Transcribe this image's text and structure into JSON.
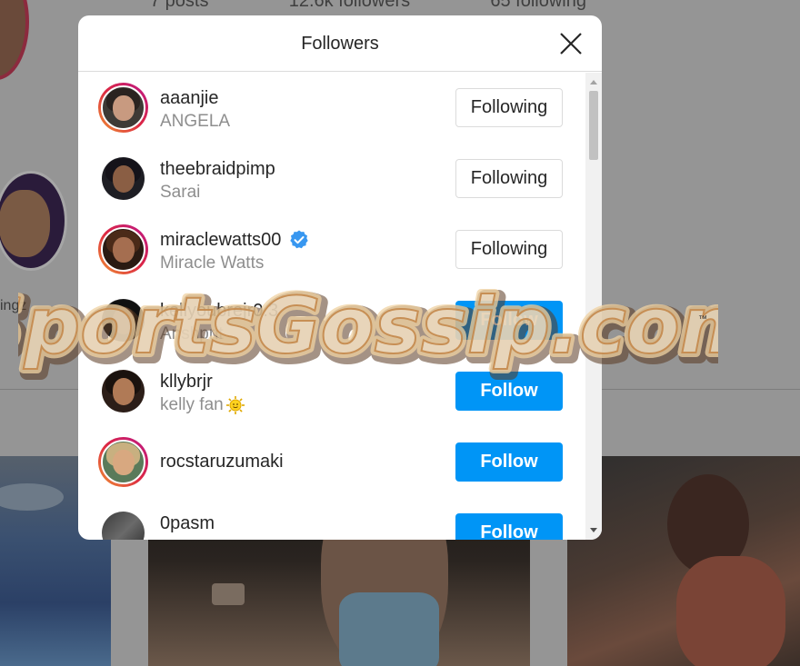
{
  "background": {
    "stats": [
      "7 posts",
      "12.6k followers",
      "65 following"
    ],
    "highlight_label": "ingz"
  },
  "modal": {
    "title": "Followers",
    "close_icon": "close-icon"
  },
  "followers": [
    {
      "username": "aaanjie",
      "full_name": "ANGELA",
      "button": "Following",
      "story_ring": true,
      "verified": false
    },
    {
      "username": "theebraidpimp",
      "full_name": "Sarai",
      "button": "Following",
      "story_ring": false,
      "verified": false
    },
    {
      "username": "miraclewatts00",
      "full_name": "Miracle Watts",
      "button": "Following",
      "story_ring": true,
      "verified": true
    },
    {
      "username": "kellyoubrejr0.3",
      "full_name": "Anshprit",
      "button": "Follow",
      "story_ring": false,
      "verified": false
    },
    {
      "username": "kllybrjr",
      "full_name": "kelly fan",
      "button": "Follow",
      "story_ring": false,
      "verified": false,
      "emoji": "sun-emoji"
    },
    {
      "username": "rocstaruzumaki",
      "full_name": "",
      "button": "Follow",
      "story_ring": true,
      "verified": false
    },
    {
      "username": "0pasm",
      "full_name": "",
      "button": "Follow",
      "story_ring": false,
      "verified": false
    }
  ],
  "watermark": {
    "text": "SportsGossip.com",
    "trademark": "™"
  },
  "colors": {
    "follow_blue": "#0095f6",
    "verified_blue": "#3897f0",
    "ring_gradient": [
      "#f09433",
      "#dc2743",
      "#bc1888"
    ]
  }
}
